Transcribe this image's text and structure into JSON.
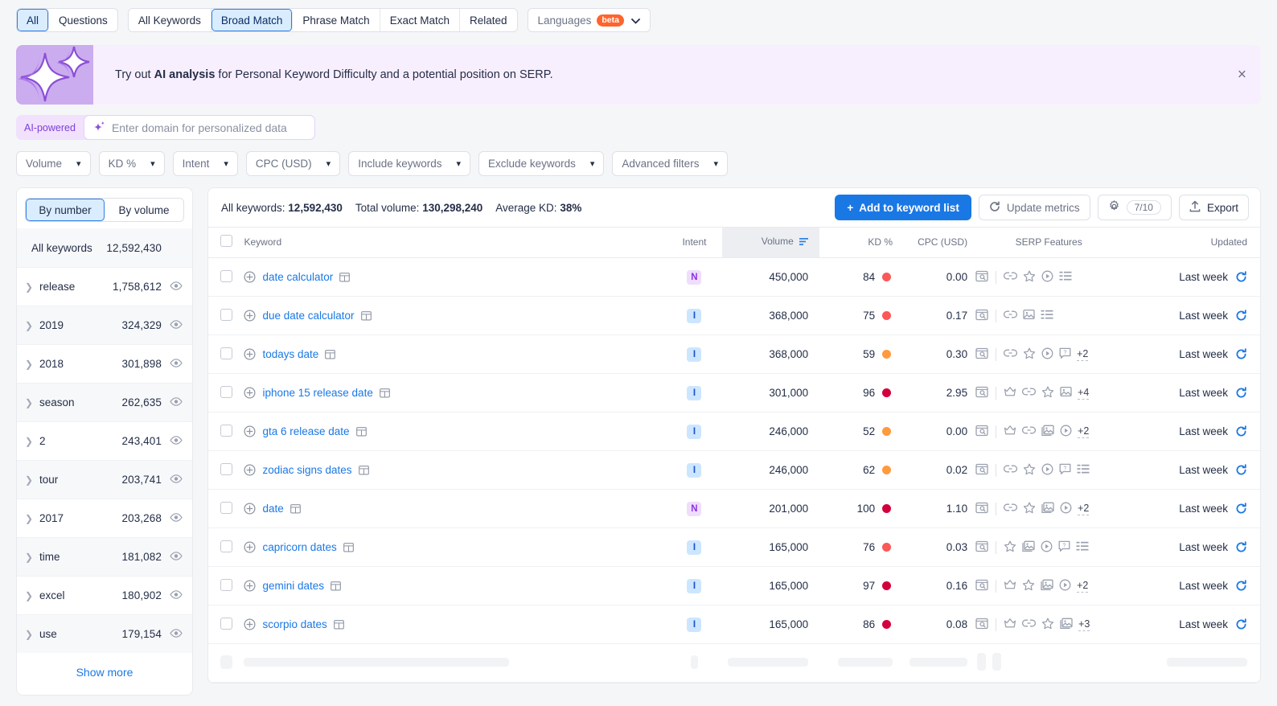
{
  "topbar": {
    "group_a": [
      {
        "label": "All",
        "active": true
      },
      {
        "label": "Questions",
        "active": false
      }
    ],
    "group_b": [
      {
        "label": "All Keywords",
        "active": false
      },
      {
        "label": "Broad Match",
        "active": true
      },
      {
        "label": "Phrase Match",
        "active": false
      },
      {
        "label": "Exact Match",
        "active": false
      },
      {
        "label": "Related",
        "active": false
      }
    ],
    "languages": {
      "label": "Languages",
      "badge": "beta",
      "caret": "chevron-down-icon"
    }
  },
  "banner": {
    "text_before": "Try out ",
    "text_bold": "AI analysis",
    "text_after": " for Personal Keyword Difficulty and a potential position on SERP.",
    "close": "×",
    "art": "sparkles-icon",
    "bg": "#f8effe",
    "art_bg": "#cbacef"
  },
  "ai_input": {
    "label": "AI-powered",
    "placeholder": "Enter domain for personalized data",
    "value": "",
    "icon": "sparkle-icon"
  },
  "filters": [
    {
      "label": "Volume"
    },
    {
      "label": "KD %"
    },
    {
      "label": "Intent"
    },
    {
      "label": "CPC (USD)"
    },
    {
      "label": "Include keywords"
    },
    {
      "label": "Exclude keywords"
    },
    {
      "label": "Advanced filters"
    }
  ],
  "sidebar": {
    "toggle": [
      {
        "label": "By number",
        "active": true
      },
      {
        "label": "By volume",
        "active": false
      }
    ],
    "all_keywords": {
      "label": "All keywords",
      "count": "12,592,430"
    },
    "items": [
      {
        "label": "release",
        "count": "1,758,612"
      },
      {
        "label": "2019",
        "count": "324,329"
      },
      {
        "label": "2018",
        "count": "301,898"
      },
      {
        "label": "season",
        "count": "262,635"
      },
      {
        "label": "2",
        "count": "243,401"
      },
      {
        "label": "tour",
        "count": "203,741"
      },
      {
        "label": "2017",
        "count": "203,268"
      },
      {
        "label": "time",
        "count": "181,082"
      },
      {
        "label": "excel",
        "count": "180,902"
      },
      {
        "label": "use",
        "count": "179,154"
      }
    ],
    "show_more": "Show more"
  },
  "toolbar": {
    "all_keywords_label": "All keywords:",
    "all_keywords_value": "12,592,430",
    "total_volume_label": "Total volume:",
    "total_volume_value": "130,298,240",
    "average_kd_label": "Average KD:",
    "average_kd_value": "38%",
    "add_to_list": "Add to keyword list",
    "update_metrics": "Update metrics",
    "settings_count": "7/10",
    "export": "Export"
  },
  "table": {
    "columns": {
      "keyword": "Keyword",
      "intent": "Intent",
      "volume": "Volume",
      "kd": "KD %",
      "cpc": "CPC (USD)",
      "serp": "SERP Features",
      "updated": "Updated"
    },
    "rows": [
      {
        "keyword": "date calculator",
        "intent": "N",
        "volume": "450,000",
        "kd": "84",
        "kd_color": "#fc5857",
        "cpc": "0.00",
        "serp": [
          "serp-preview-icon",
          "link-icon",
          "star-icon",
          "video-icon",
          "list-icon"
        ],
        "plus": "",
        "updated": "Last week"
      },
      {
        "keyword": "due date calculator",
        "intent": "I",
        "volume": "368,000",
        "kd": "75",
        "kd_color": "#fc5857",
        "cpc": "0.17",
        "serp": [
          "serp-preview-icon",
          "link-icon",
          "image-icon",
          "list-icon"
        ],
        "plus": "",
        "updated": "Last week"
      },
      {
        "keyword": "todays date",
        "intent": "I",
        "volume": "368,000",
        "kd": "59",
        "kd_color": "#ff9a3d",
        "cpc": "0.30",
        "serp": [
          "serp-preview-icon",
          "link-icon",
          "star-icon",
          "video-icon",
          "question-icon"
        ],
        "plus": "+2",
        "updated": "Last week"
      },
      {
        "keyword": "iphone 15 release date",
        "intent": "I",
        "volume": "301,000",
        "kd": "96",
        "kd_color": "#d4003c",
        "cpc": "2.95",
        "serp": [
          "serp-preview-icon",
          "crown-icon",
          "link-icon",
          "star-icon",
          "image-icon"
        ],
        "plus": "+4",
        "updated": "Last week"
      },
      {
        "keyword": "gta 6 release date",
        "intent": "I",
        "volume": "246,000",
        "kd": "52",
        "kd_color": "#ff9a3d",
        "cpc": "0.00",
        "serp": [
          "serp-preview-icon",
          "crown-icon",
          "link-icon",
          "images-icon",
          "video-icon"
        ],
        "plus": "+2",
        "updated": "Last week"
      },
      {
        "keyword": "zodiac signs dates",
        "intent": "I",
        "volume": "246,000",
        "kd": "62",
        "kd_color": "#ff9a3d",
        "cpc": "0.02",
        "serp": [
          "serp-preview-icon",
          "link-icon",
          "star-icon",
          "video-icon",
          "question-icon",
          "list-icon"
        ],
        "plus": "",
        "updated": "Last week"
      },
      {
        "keyword": "date",
        "intent": "N",
        "volume": "201,000",
        "kd": "100",
        "kd_color": "#d4003c",
        "cpc": "1.10",
        "serp": [
          "serp-preview-icon",
          "link-icon",
          "star-icon",
          "images-icon",
          "video-icon"
        ],
        "plus": "+2",
        "updated": "Last week"
      },
      {
        "keyword": "capricorn dates",
        "intent": "I",
        "volume": "165,000",
        "kd": "76",
        "kd_color": "#fc5857",
        "cpc": "0.03",
        "serp": [
          "serp-preview-icon",
          "star-icon",
          "images-icon",
          "video-icon",
          "question-icon",
          "list-icon"
        ],
        "plus": "",
        "updated": "Last week"
      },
      {
        "keyword": "gemini dates",
        "intent": "I",
        "volume": "165,000",
        "kd": "97",
        "kd_color": "#d4003c",
        "cpc": "0.16",
        "serp": [
          "serp-preview-icon",
          "crown-icon",
          "star-icon",
          "images-icon",
          "video-icon"
        ],
        "plus": "+2",
        "updated": "Last week"
      },
      {
        "keyword": "scorpio dates",
        "intent": "I",
        "volume": "165,000",
        "kd": "86",
        "kd_color": "#d4003c",
        "cpc": "0.08",
        "serp": [
          "serp-preview-icon",
          "crown-icon",
          "link-icon",
          "star-icon",
          "images-icon"
        ],
        "plus": "+3",
        "updated": "Last week"
      }
    ]
  }
}
